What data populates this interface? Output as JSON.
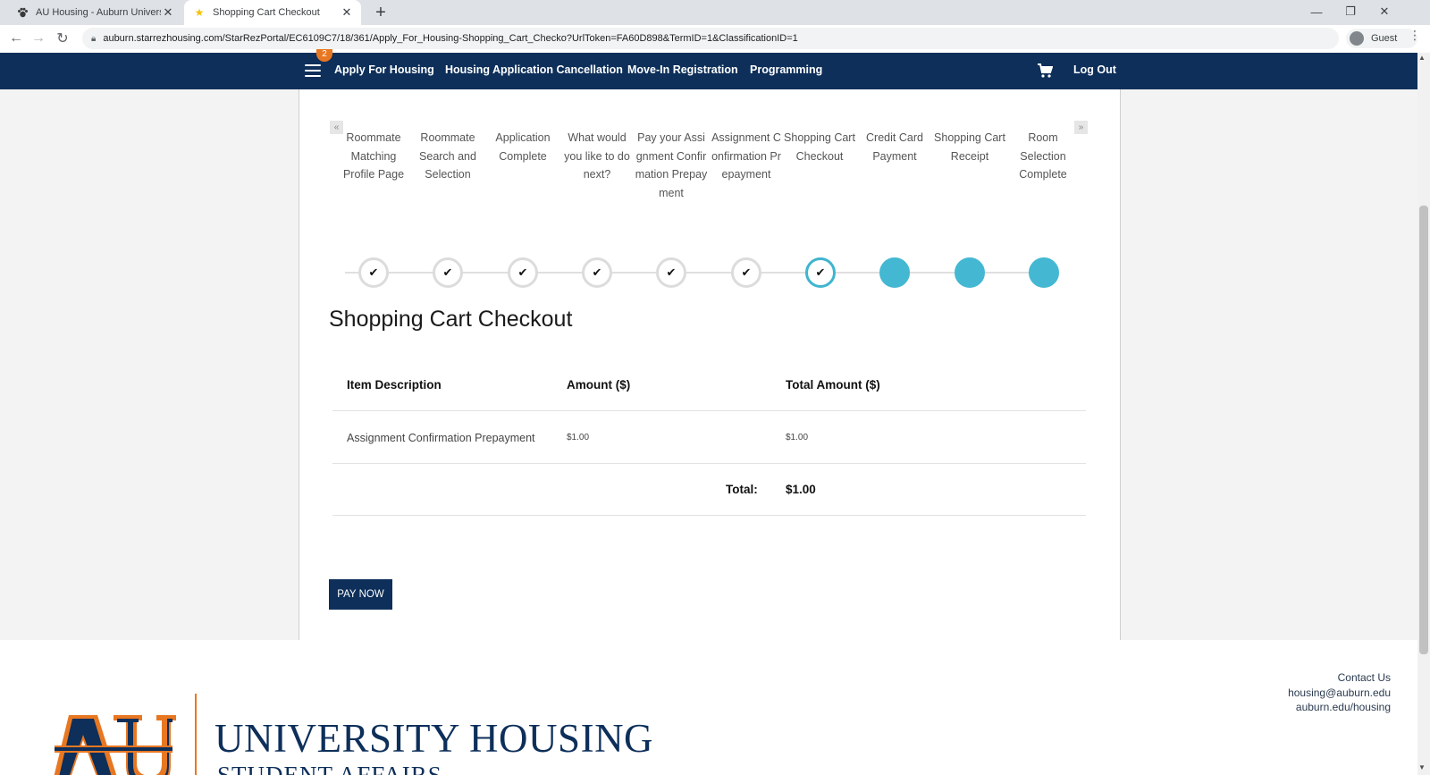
{
  "browser": {
    "tabs": [
      {
        "title": "AU Housing - Auburn University",
        "active": false,
        "favicon": "paw-icon"
      },
      {
        "title": "Shopping Cart Checkout",
        "active": true,
        "favicon": "star-icon"
      }
    ],
    "url": "auburn.starrezhousing.com/StarRezPortal/EC6109C7/18/361/Apply_For_Housing-Shopping_Cart_Checko?UrlToken=FA60D898&TermID=1&ClassificationID=1",
    "profile_label": "Guest"
  },
  "nav": {
    "badge": "2",
    "links": [
      "Apply For Housing",
      "Housing Application Cancellation",
      "Move-In Registration",
      "Programming"
    ],
    "logout": "Log Out"
  },
  "steps": {
    "prev_arrow": "«",
    "next_arrow": "»",
    "items": [
      {
        "label": "Roommate Matching Profile Page",
        "status": "done"
      },
      {
        "label": "Roommate Search and Selection",
        "status": "done"
      },
      {
        "label": "Application Complete",
        "status": "done"
      },
      {
        "label": "What would you like to do next?",
        "status": "done"
      },
      {
        "label": "Pay your Assignment Confirmation Prepayment",
        "status": "done"
      },
      {
        "label": "Assignment Confirmation Prepayment",
        "status": "done"
      },
      {
        "label": "Shopping Cart Checkout",
        "status": "current"
      },
      {
        "label": "Credit Card Payment",
        "status": "todo"
      },
      {
        "label": "Shopping Cart Receipt",
        "status": "todo"
      },
      {
        "label": "Room Selection Complete",
        "status": "todo"
      }
    ]
  },
  "page": {
    "title": "Shopping Cart Checkout"
  },
  "cart": {
    "headers": [
      "Item Description",
      "Amount ($)",
      "Total Amount ($)"
    ],
    "rows": [
      {
        "description": "Assignment Confirmation Prepayment",
        "amount": "$1.00",
        "total": "$1.00"
      }
    ],
    "total_label": "Total:",
    "total_value": "$1.00"
  },
  "actions": {
    "pay_now": "PAY NOW"
  },
  "footer": {
    "contact": [
      "Contact Us",
      "housing@auburn.edu",
      "auburn.edu/housing"
    ],
    "logo_title": "UNIVERSITY HOUSING",
    "logo_subtitle": "STUDENT AFFAIRS"
  },
  "colors": {
    "navy": "#0d2f5a",
    "orange": "#e87722",
    "teal": "#44b8d2"
  }
}
